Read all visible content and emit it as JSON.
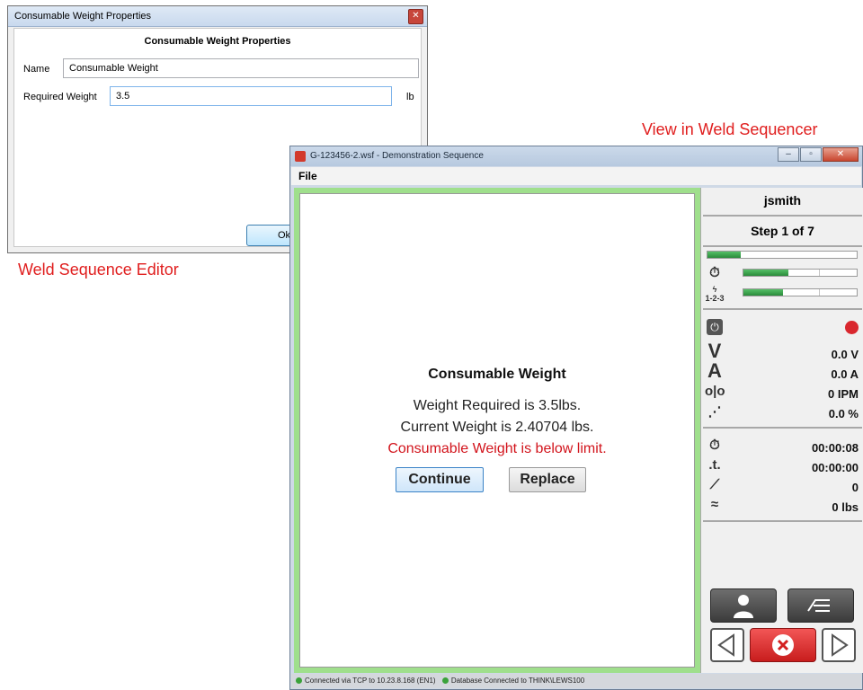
{
  "editor": {
    "window_title": "Consumable Weight Properties",
    "heading": "Consumable Weight Properties",
    "name_label": "Name",
    "name_value": "Consumable Weight",
    "weight_label": "Required Weight",
    "weight_value": "3.5",
    "unit": "lb",
    "ok_label": "Ok",
    "close_icon": "close-icon"
  },
  "captions": {
    "editor": "Weld Sequence Editor",
    "sequencer": "View in Weld Sequencer"
  },
  "sequencer": {
    "window_title": "G-123456-2.wsf - Demonstration Sequence",
    "menu": {
      "file": "File"
    },
    "dialog": {
      "title": "Consumable Weight",
      "line1": "Weight Required is 3.5lbs.",
      "line2": "Current Weight is 2.40704 lbs.",
      "warning": "Consumable Weight is below limit.",
      "continue_label": "Continue",
      "replace_label": "Replace"
    },
    "side": {
      "user": "jsmith",
      "step": "Step 1 of 7",
      "progress": {
        "step": 0.22,
        "time": 0.4,
        "sequence": 0.35
      },
      "voltage": "0.0 V",
      "amperage": "0.0 A",
      "wire_feed": "0 IPM",
      "percent": "0.0 %",
      "arc_time": "00:00:08",
      "total_time": "00:00:00",
      "count": "0",
      "weight": "0 lbs",
      "recording_color": "#d9272e"
    },
    "status": {
      "tcp": "Connected via TCP to 10.23.8.168 (EN1)",
      "db": "Database Connected to THINK\\LEWS100"
    }
  }
}
